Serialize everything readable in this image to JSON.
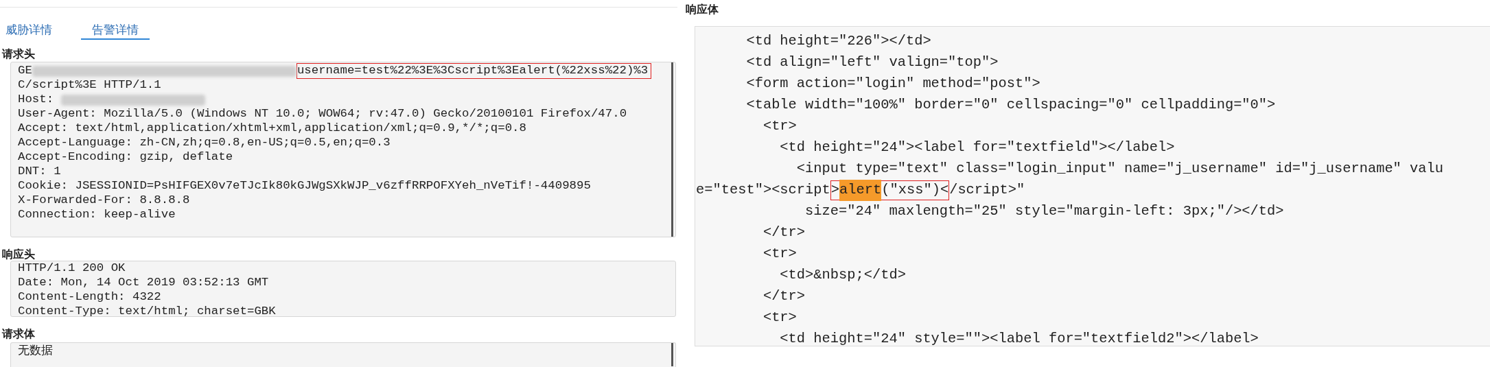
{
  "tabs": [
    {
      "label": "威胁详情",
      "selected": false
    },
    {
      "label": "告警详情",
      "selected": true
    }
  ],
  "request_header": {
    "title": "请求头",
    "lines": [
      {
        "before": "GE",
        "redacted": true,
        "boxed": [
          {
            "text": "username=test%22%3E%3Cscript%3Ealert(%22xss%22)%3",
            "highlighted": false
          }
        ]
      },
      {
        "before": "C/script%3E HTTP/1.1"
      },
      {
        "before": "Host: ",
        "redacted": true
      },
      {
        "before": "User-Agent: Mozilla/5.0 (Windows NT 10.0; WOW64; rv:47.0) Gecko/20100101 Firefox/47.0"
      },
      {
        "before": "Accept: text/html,application/xhtml+xml,application/xml;q=0.9,*/*;q=0.8"
      },
      {
        "before": "Accept-Language: zh-CN,zh;q=0.8,en-US;q=0.5,en;q=0.3"
      },
      {
        "before": "Accept-Encoding: gzip, deflate"
      },
      {
        "before": "DNT: 1"
      },
      {
        "before": "Cookie: JSESSIONID=PsHIFGEX0v7eTJcIk80kGJWgSXkWJP_v6zffRRPOFXYeh_nVeTif!-4409895"
      },
      {
        "before": "X-Forwarded-For: 8.8.8.8"
      },
      {
        "before": "Connection: keep-alive"
      }
    ]
  },
  "response_header": {
    "title": "响应头",
    "lines": [
      {
        "before": "HTTP/1.1 200 OK"
      },
      {
        "before": "Date: Mon, 14 Oct 2019 03:52:13 GMT"
      },
      {
        "before": "Content-Length: 4322"
      },
      {
        "before": "Content-Type: text/html; charset=GBK"
      }
    ]
  },
  "request_body": {
    "title": "请求体",
    "lines": [
      {
        "before": "无数据"
      }
    ]
  },
  "response_body": {
    "title": "响应体",
    "lines": [
      {
        "before": "      <td height=\"226\"></td>"
      },
      {
        "before": "      <td align=\"left\" valign=\"top\">"
      },
      {
        "before": "      <form action=\"login\" method=\"post\">"
      },
      {
        "before": "      <table width=\"100%\" border=\"0\" cellspacing=\"0\" cellpadding=\"0\">"
      },
      {
        "before": "        <tr>"
      },
      {
        "before": "          <td height=\"24\"><label for=\"textfield\"></label>"
      },
      {
        "before": "            <input type=\"text\" class=\"login_input\" name=\"j_username\" id=\"j_username\" valu"
      },
      {
        "before": "e=\"test\"><script",
        "boxed": [
          {
            "text": ">",
            "highlighted": false
          },
          {
            "text": "alert",
            "highlighted": true
          },
          {
            "text": "(\"xss\")<",
            "highlighted": false
          }
        ],
        "after": "/script>\""
      },
      {
        "before": "             size=\"24\" maxlength=\"25\" style=\"margin-left: 3px;\"/></td>"
      },
      {
        "before": "        </tr>"
      },
      {
        "before": "        <tr>"
      },
      {
        "before": "          <td>&nbsp;</td>"
      },
      {
        "before": "        </tr>"
      },
      {
        "before": "        <tr>"
      },
      {
        "before": "          <td height=\"24\" style=\"\"><label for=\"textfield2\"></label>"
      }
    ]
  }
}
